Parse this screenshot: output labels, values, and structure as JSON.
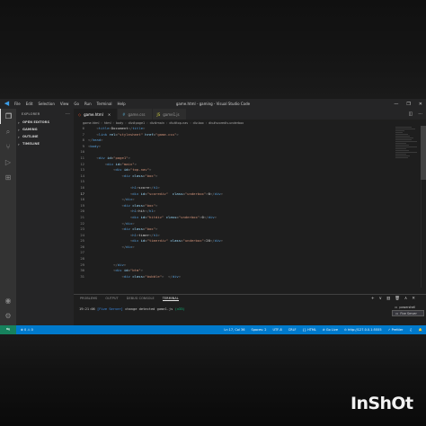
{
  "window": {
    "title": "game.html - gaming - Visual Studio Code",
    "menu": [
      "File",
      "Edit",
      "Selection",
      "View",
      "Go",
      "Run",
      "Terminal",
      "Help"
    ],
    "controls": [
      "—",
      "❐",
      "✕"
    ]
  },
  "activity_bar": {
    "items": [
      {
        "name": "explorer",
        "glyph": "❐"
      },
      {
        "name": "search",
        "glyph": "⌕"
      },
      {
        "name": "source-control",
        "glyph": "⑂"
      },
      {
        "name": "run-debug",
        "glyph": "▷"
      },
      {
        "name": "extensions",
        "glyph": "⊞"
      }
    ],
    "bottom": [
      {
        "name": "accounts",
        "glyph": "◉"
      },
      {
        "name": "manage",
        "glyph": "⚙"
      }
    ]
  },
  "sidebar": {
    "title": "EXPLORER",
    "more": "···",
    "sections": [
      {
        "label": "OPEN EDITORS"
      },
      {
        "label": "GAMING"
      },
      {
        "label": "OUTLINE"
      },
      {
        "label": "TIMELINE"
      }
    ]
  },
  "tabs": [
    {
      "label": "game.html",
      "icon": "◇",
      "icon_color": "#e44d26",
      "active": true
    },
    {
      "label": "game.css",
      "icon": "#",
      "icon_color": "#519aba",
      "active": false
    },
    {
      "label": "game1.js",
      "icon": "JS",
      "icon_color": "#cbcb41",
      "active": false
    }
  ],
  "editor_actions": [
    "◫",
    "···"
  ],
  "breadcrumb": [
    "game.html",
    "html",
    "body",
    "div#page1",
    "div#main",
    "div#top-nav",
    "div.box",
    "div#scorediv.underbox"
  ],
  "code_lines": [
    {
      "n": "6",
      "segs": [
        [
          "t",
          "    "
        ],
        [
          "b",
          "<"
        ],
        [
          "k",
          "title"
        ],
        [
          "b",
          ">"
        ],
        [
          "t",
          "Document"
        ],
        [
          "b",
          "</"
        ],
        [
          "k",
          "title"
        ],
        [
          "b",
          ">"
        ]
      ]
    },
    {
      "n": "7",
      "segs": [
        [
          "t",
          "    "
        ],
        [
          "b",
          "<"
        ],
        [
          "k",
          "link"
        ],
        [
          "t",
          " "
        ],
        [
          "a",
          "rel"
        ],
        [
          "t",
          "="
        ],
        [
          "s",
          "\"stylesheet\""
        ],
        [
          "t",
          " "
        ],
        [
          "a",
          "href"
        ],
        [
          "t",
          "="
        ],
        [
          "s",
          "\"game.css\""
        ],
        [
          "b",
          ">"
        ]
      ]
    },
    {
      "n": "8",
      "segs": [
        [
          "b",
          "</"
        ],
        [
          "k",
          "head"
        ],
        [
          "b",
          ">"
        ]
      ]
    },
    {
      "n": "9",
      "segs": [
        [
          "b",
          "<"
        ],
        [
          "k",
          "body"
        ],
        [
          "b",
          ">"
        ]
      ]
    },
    {
      "n": "10",
      "segs": [
        [
          "t",
          ""
        ]
      ]
    },
    {
      "n": "11",
      "segs": [
        [
          "t",
          "    "
        ],
        [
          "b",
          "<"
        ],
        [
          "k",
          "div"
        ],
        [
          "t",
          " "
        ],
        [
          "a",
          "id"
        ],
        [
          "t",
          "="
        ],
        [
          "s",
          "\"page1\""
        ],
        [
          "b",
          ">"
        ]
      ]
    },
    {
      "n": "12",
      "segs": [
        [
          "t",
          "        "
        ],
        [
          "b",
          "<"
        ],
        [
          "k",
          "div"
        ],
        [
          "t",
          " "
        ],
        [
          "a",
          "id"
        ],
        [
          "t",
          "="
        ],
        [
          "s",
          "\"main\""
        ],
        [
          "b",
          ">"
        ]
      ]
    },
    {
      "n": "13",
      "segs": [
        [
          "t",
          "            "
        ],
        [
          "b",
          "<"
        ],
        [
          "k",
          "div"
        ],
        [
          "t",
          " "
        ],
        [
          "a",
          "id"
        ],
        [
          "t",
          "="
        ],
        [
          "s",
          "\"top-nav\""
        ],
        [
          "b",
          ">"
        ]
      ]
    },
    {
      "n": "14",
      "segs": [
        [
          "t",
          "                "
        ],
        [
          "b",
          "<"
        ],
        [
          "k",
          "div"
        ],
        [
          "t",
          " "
        ],
        [
          "a",
          "class"
        ],
        [
          "t",
          "="
        ],
        [
          "s",
          "\"box\""
        ],
        [
          "b",
          ">"
        ]
      ]
    },
    {
      "n": "15",
      "segs": [
        [
          "t",
          ""
        ]
      ]
    },
    {
      "n": "16",
      "segs": [
        [
          "t",
          "                    "
        ],
        [
          "b",
          "<"
        ],
        [
          "k",
          "h1"
        ],
        [
          "b",
          ">"
        ],
        [
          "t",
          "score"
        ],
        [
          "b",
          "</"
        ],
        [
          "k",
          "h1"
        ],
        [
          "b",
          ">"
        ]
      ]
    },
    {
      "n": "17",
      "current": true,
      "segs": [
        [
          "t",
          "                    "
        ],
        [
          "b",
          "<"
        ],
        [
          "k",
          "div"
        ],
        [
          "t",
          " "
        ],
        [
          "a",
          "id"
        ],
        [
          "t",
          "="
        ],
        [
          "s",
          "\"scorediv\""
        ],
        [
          "t",
          "  "
        ],
        [
          "a",
          "class"
        ],
        [
          "t",
          "="
        ],
        [
          "s",
          "\"underbox\""
        ],
        [
          "b",
          ">"
        ],
        [
          "t",
          "0"
        ],
        [
          "b",
          "</"
        ],
        [
          "k",
          "div"
        ],
        [
          "b",
          ">"
        ]
      ]
    },
    {
      "n": "18",
      "segs": [
        [
          "t",
          "                "
        ],
        [
          "b",
          "</"
        ],
        [
          "k",
          "div"
        ],
        [
          "b",
          ">"
        ]
      ]
    },
    {
      "n": "19",
      "segs": [
        [
          "t",
          "                "
        ],
        [
          "b",
          "<"
        ],
        [
          "k",
          "div"
        ],
        [
          "t",
          " "
        ],
        [
          "a",
          "class"
        ],
        [
          "t",
          "="
        ],
        [
          "s",
          "\"box\""
        ],
        [
          "b",
          ">"
        ]
      ]
    },
    {
      "n": "20",
      "segs": [
        [
          "t",
          "                    "
        ],
        [
          "b",
          "<"
        ],
        [
          "k",
          "h1"
        ],
        [
          "b",
          ">"
        ],
        [
          "t",
          "hit"
        ],
        [
          "b",
          "</"
        ],
        [
          "k",
          "h1"
        ],
        [
          "b",
          ">"
        ]
      ]
    },
    {
      "n": "21",
      "segs": [
        [
          "t",
          "                    "
        ],
        [
          "b",
          "<"
        ],
        [
          "k",
          "div"
        ],
        [
          "t",
          " "
        ],
        [
          "a",
          "id"
        ],
        [
          "t",
          "="
        ],
        [
          "s",
          "\"hitdiv\""
        ],
        [
          "t",
          " "
        ],
        [
          "a",
          "class"
        ],
        [
          "t",
          "="
        ],
        [
          "s",
          "\"underbox\""
        ],
        [
          "b",
          ">"
        ],
        [
          "t",
          "0"
        ],
        [
          "b",
          "</"
        ],
        [
          "k",
          "div"
        ],
        [
          "b",
          ">"
        ]
      ]
    },
    {
      "n": "22",
      "segs": [
        [
          "t",
          "                "
        ],
        [
          "b",
          "</"
        ],
        [
          "k",
          "div"
        ],
        [
          "b",
          ">"
        ]
      ]
    },
    {
      "n": "23",
      "segs": [
        [
          "t",
          "                "
        ],
        [
          "b",
          "<"
        ],
        [
          "k",
          "div"
        ],
        [
          "t",
          " "
        ],
        [
          "a",
          "class"
        ],
        [
          "t",
          "="
        ],
        [
          "s",
          "\"box\""
        ],
        [
          "b",
          ">"
        ]
      ]
    },
    {
      "n": "24",
      "segs": [
        [
          "t",
          "                    "
        ],
        [
          "b",
          "<"
        ],
        [
          "k",
          "h1"
        ],
        [
          "b",
          ">"
        ],
        [
          "t",
          "timer"
        ],
        [
          "b",
          "</"
        ],
        [
          "k",
          "h1"
        ],
        [
          "b",
          ">"
        ]
      ]
    },
    {
      "n": "25",
      "segs": [
        [
          "t",
          "                    "
        ],
        [
          "b",
          "<"
        ],
        [
          "k",
          "div"
        ],
        [
          "t",
          " "
        ],
        [
          "a",
          "id"
        ],
        [
          "t",
          "="
        ],
        [
          "s",
          "\"timerdiv\""
        ],
        [
          "t",
          " "
        ],
        [
          "a",
          "class"
        ],
        [
          "t",
          "="
        ],
        [
          "s",
          "\"underbox\""
        ],
        [
          "b",
          ">"
        ],
        [
          "t",
          "20"
        ],
        [
          "b",
          "</"
        ],
        [
          "k",
          "div"
        ],
        [
          "b",
          ">"
        ]
      ]
    },
    {
      "n": "26",
      "segs": [
        [
          "t",
          "                "
        ],
        [
          "b",
          "</"
        ],
        [
          "k",
          "div"
        ],
        [
          "b",
          ">"
        ]
      ]
    },
    {
      "n": "27",
      "segs": [
        [
          "t",
          ""
        ]
      ]
    },
    {
      "n": "28",
      "segs": [
        [
          "t",
          ""
        ]
      ]
    },
    {
      "n": "29",
      "segs": [
        [
          "t",
          "            "
        ],
        [
          "b",
          "</"
        ],
        [
          "k",
          "div"
        ],
        [
          "b",
          ">"
        ]
      ]
    },
    {
      "n": "30",
      "segs": [
        [
          "t",
          "            "
        ],
        [
          "b",
          "<"
        ],
        [
          "k",
          "div"
        ],
        [
          "t",
          " "
        ],
        [
          "a",
          "id"
        ],
        [
          "t",
          "="
        ],
        [
          "s",
          "\"btm\""
        ],
        [
          "b",
          ">"
        ]
      ]
    },
    {
      "n": "31",
      "segs": [
        [
          "t",
          "                "
        ],
        [
          "b",
          "<"
        ],
        [
          "k",
          "div"
        ],
        [
          "t",
          " "
        ],
        [
          "a",
          "class"
        ],
        [
          "t",
          "="
        ],
        [
          "s",
          "\"bubble\""
        ],
        [
          "b",
          ">"
        ],
        [
          "t",
          "  "
        ],
        [
          "b",
          "</"
        ],
        [
          "k",
          "div"
        ],
        [
          "b",
          ">"
        ]
      ]
    }
  ],
  "panel": {
    "tabs": [
      {
        "label": "PROBLEMS",
        "active": false
      },
      {
        "label": "OUTPUT",
        "active": false
      },
      {
        "label": "DEBUG CONSOLE",
        "active": false
      },
      {
        "label": "TERMINAL",
        "active": true
      }
    ],
    "actions": [
      "+",
      "∨",
      "▥",
      "🗑",
      "∧",
      "✕"
    ],
    "terminal": {
      "timestamp": "19:21:06",
      "server": "[Five Server]",
      "message": " change detected game1.js ",
      "version": "(v33)"
    },
    "terminal_list": [
      {
        "label": "powershell",
        "icon": "▭",
        "active": false
      },
      {
        "label": "Five Server",
        "icon": "▭",
        "active": true
      }
    ]
  },
  "status_bar": {
    "remote": "⇋",
    "left": [
      "⊗ 0 ⚠ 0"
    ],
    "right": [
      "Ln 17, Col 36",
      "Spaces: 2",
      "UTF-8",
      "CRLF",
      "{} HTML",
      "⊘ Go Live",
      "⊙ http://127.0.0.1:5555",
      "✓ Prettier",
      "♫",
      "🔔"
    ]
  },
  "watermark": "InShOt"
}
